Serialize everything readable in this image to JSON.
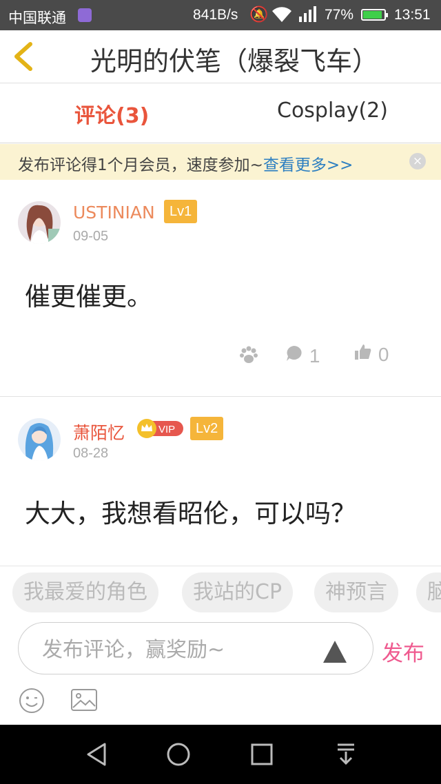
{
  "status_bar": {
    "carrier": "中国联通",
    "speed": "841B/s",
    "battery_percent": "77%",
    "time": "13:51",
    "icons": [
      "app-notification-icon",
      "mute-icon",
      "wifi-icon",
      "signal-icon",
      "battery-icon"
    ]
  },
  "header": {
    "title": "光明的伏笔（爆裂飞车）",
    "back_icon": "chevron-left-icon"
  },
  "tabs": [
    {
      "label": "评论(3)",
      "active": true
    },
    {
      "label": "Cosplay(2)",
      "active": false
    }
  ],
  "notice": {
    "text": "发布评论得1个月会员，速度参加~",
    "link": "查看更多>>",
    "close_icon": "×"
  },
  "comments": [
    {
      "username": "USTINIAN",
      "level": "Lv1",
      "date": "09-05",
      "text": "催更催更。",
      "reply_count": "1",
      "like_count": "0"
    },
    {
      "username": "萧陌忆",
      "vip": "VIP",
      "level": "Lv2",
      "date": "08-28",
      "text": "大大，我想看昭伦，可以吗？"
    }
  ],
  "tags": [
    "我最爱的角色",
    "我站的CP",
    "神预言",
    "脑"
  ],
  "composer": {
    "placeholder": "发布评论，赢奖励~",
    "publish_label": "发布"
  },
  "colors": {
    "accent_red": "#e9553c",
    "publish_pink": "#ef5a8f",
    "level_badge": "#f5b53a",
    "notice_bg": "#fbf3d2",
    "link_blue": "#2d7fc1"
  }
}
